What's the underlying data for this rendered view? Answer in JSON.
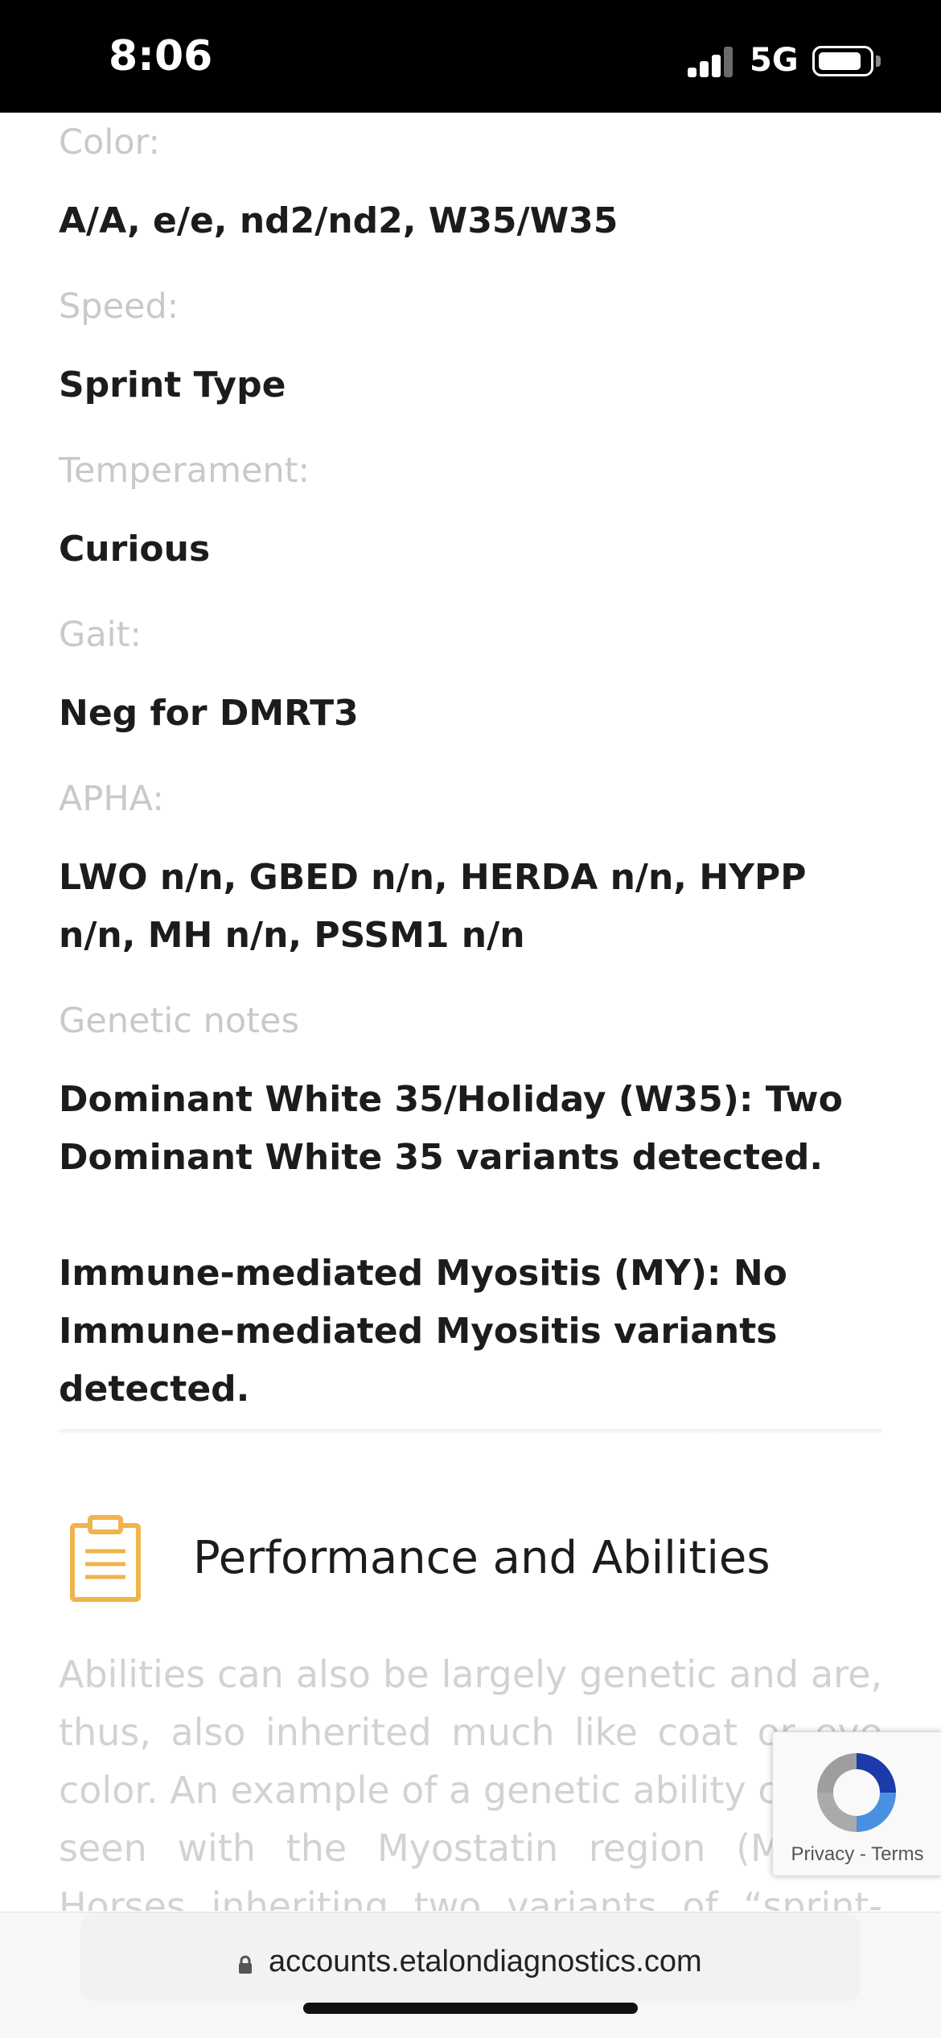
{
  "status_bar": {
    "time": "8:06",
    "network": "5G"
  },
  "fields": [
    {
      "label": "Color:",
      "value": "A/A, e/e, nd2/nd2, W35/W35"
    },
    {
      "label": "Speed:",
      "value": "Sprint Type"
    },
    {
      "label": "Temperament:",
      "value": "Curious"
    },
    {
      "label": "Gait:",
      "value": "Neg for DMRT3"
    },
    {
      "label": "APHA:",
      "value": "LWO n/n, GBED n/n, HERDA n/n, HYPP n/n, MH n/n, PSSM1 n/n"
    },
    {
      "label": "Genetic notes",
      "value": ""
    }
  ],
  "genetic_notes": [
    "Dominant White 35/Holiday (W35): Two Dominant White 35 variants detected.",
    "Immune-mediated Myositis (MY): No Immune-mediated Myositis variants detected."
  ],
  "section": {
    "icon": "clipboard-icon",
    "title": "Performance and Abilities",
    "intro": "Abilities can also be largely genetic and are, thus, also inherited much like coat or eye color. An example of a genetic ability can be seen with the Myostatin region (MSTN). Horses inheriting two variants of “sprint-type”"
  },
  "recaptcha": {
    "privacy": "Privacy",
    "separator": " - ",
    "terms": "Terms"
  },
  "browser": {
    "url": "accounts.etalondiagnostics.com"
  },
  "colors": {
    "accent_icon": "#f0b44c",
    "label_gray": "#c9c9c9",
    "value_dark": "#1c1c1c"
  }
}
